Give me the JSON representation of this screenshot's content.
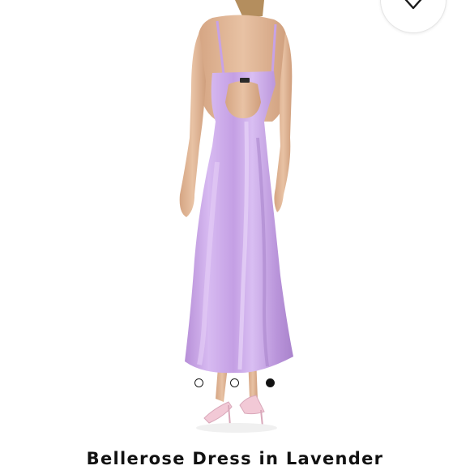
{
  "product": {
    "title": "Bellerose Dress in Lavender",
    "dress_color": "#C7A2E6",
    "skin_color": "#E3B796"
  },
  "gallery": {
    "dots": [
      {
        "label": "image 1",
        "active": false
      },
      {
        "label": "image 2",
        "active": false
      },
      {
        "label": "image 3",
        "active": true
      }
    ]
  },
  "icons": {
    "favorite": "heart-icon"
  },
  "colors": {
    "text": "#111111",
    "background": "#FFFFFF",
    "dot_active": "#111111"
  }
}
